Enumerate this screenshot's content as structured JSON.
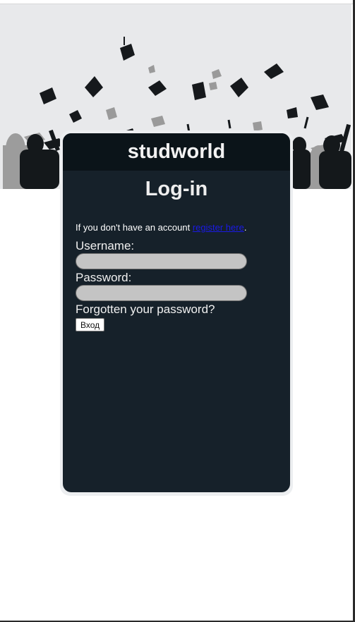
{
  "header": {
    "brand": "studworld"
  },
  "page": {
    "title": "Log-in"
  },
  "register": {
    "prefix": "If you don't have an account ",
    "link": "register here",
    "suffix": "."
  },
  "form": {
    "username_label": "Username:",
    "username_value": "",
    "password_label": "Password:",
    "password_value": "",
    "forgot_label": "Forgotten your password?",
    "submit_label": "Вход"
  },
  "colors": {
    "card": "#16212a",
    "card_header": "#0b1419",
    "hero_bg": "#e8e9eb",
    "link": "#1a1ae6",
    "input_bg": "#c4c4c4"
  },
  "icons": [
    "graduation-caps-banner"
  ]
}
